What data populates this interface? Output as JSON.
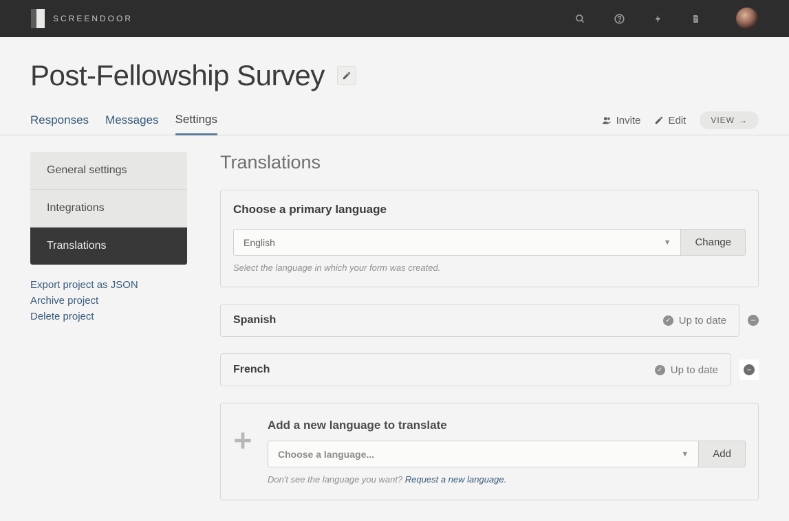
{
  "brand": "SCREENDOOR",
  "page_title": "Post-Fellowship Survey",
  "tabs": {
    "responses": "Responses",
    "messages": "Messages",
    "settings": "Settings"
  },
  "actions": {
    "invite": "Invite",
    "edit": "Edit",
    "view": "VIEW"
  },
  "sidebar": {
    "general": "General settings",
    "integrations": "Integrations",
    "translations": "Translations"
  },
  "side_links": {
    "export": "Export project as JSON",
    "archive": "Archive project",
    "delete": "Delete project"
  },
  "section_heading": "Translations",
  "primary": {
    "heading": "Choose a primary language",
    "selected": "English",
    "button": "Change",
    "helper": "Select the language in which your form was created."
  },
  "langs": {
    "spanish": {
      "name": "Spanish",
      "status": "Up to date"
    },
    "french": {
      "name": "French",
      "status": "Up to date"
    }
  },
  "add": {
    "heading": "Add a new language to translate",
    "placeholder": "Choose a language...",
    "button": "Add",
    "helper_prefix": "Don't see the language you want? ",
    "helper_link": "Request a new language."
  }
}
